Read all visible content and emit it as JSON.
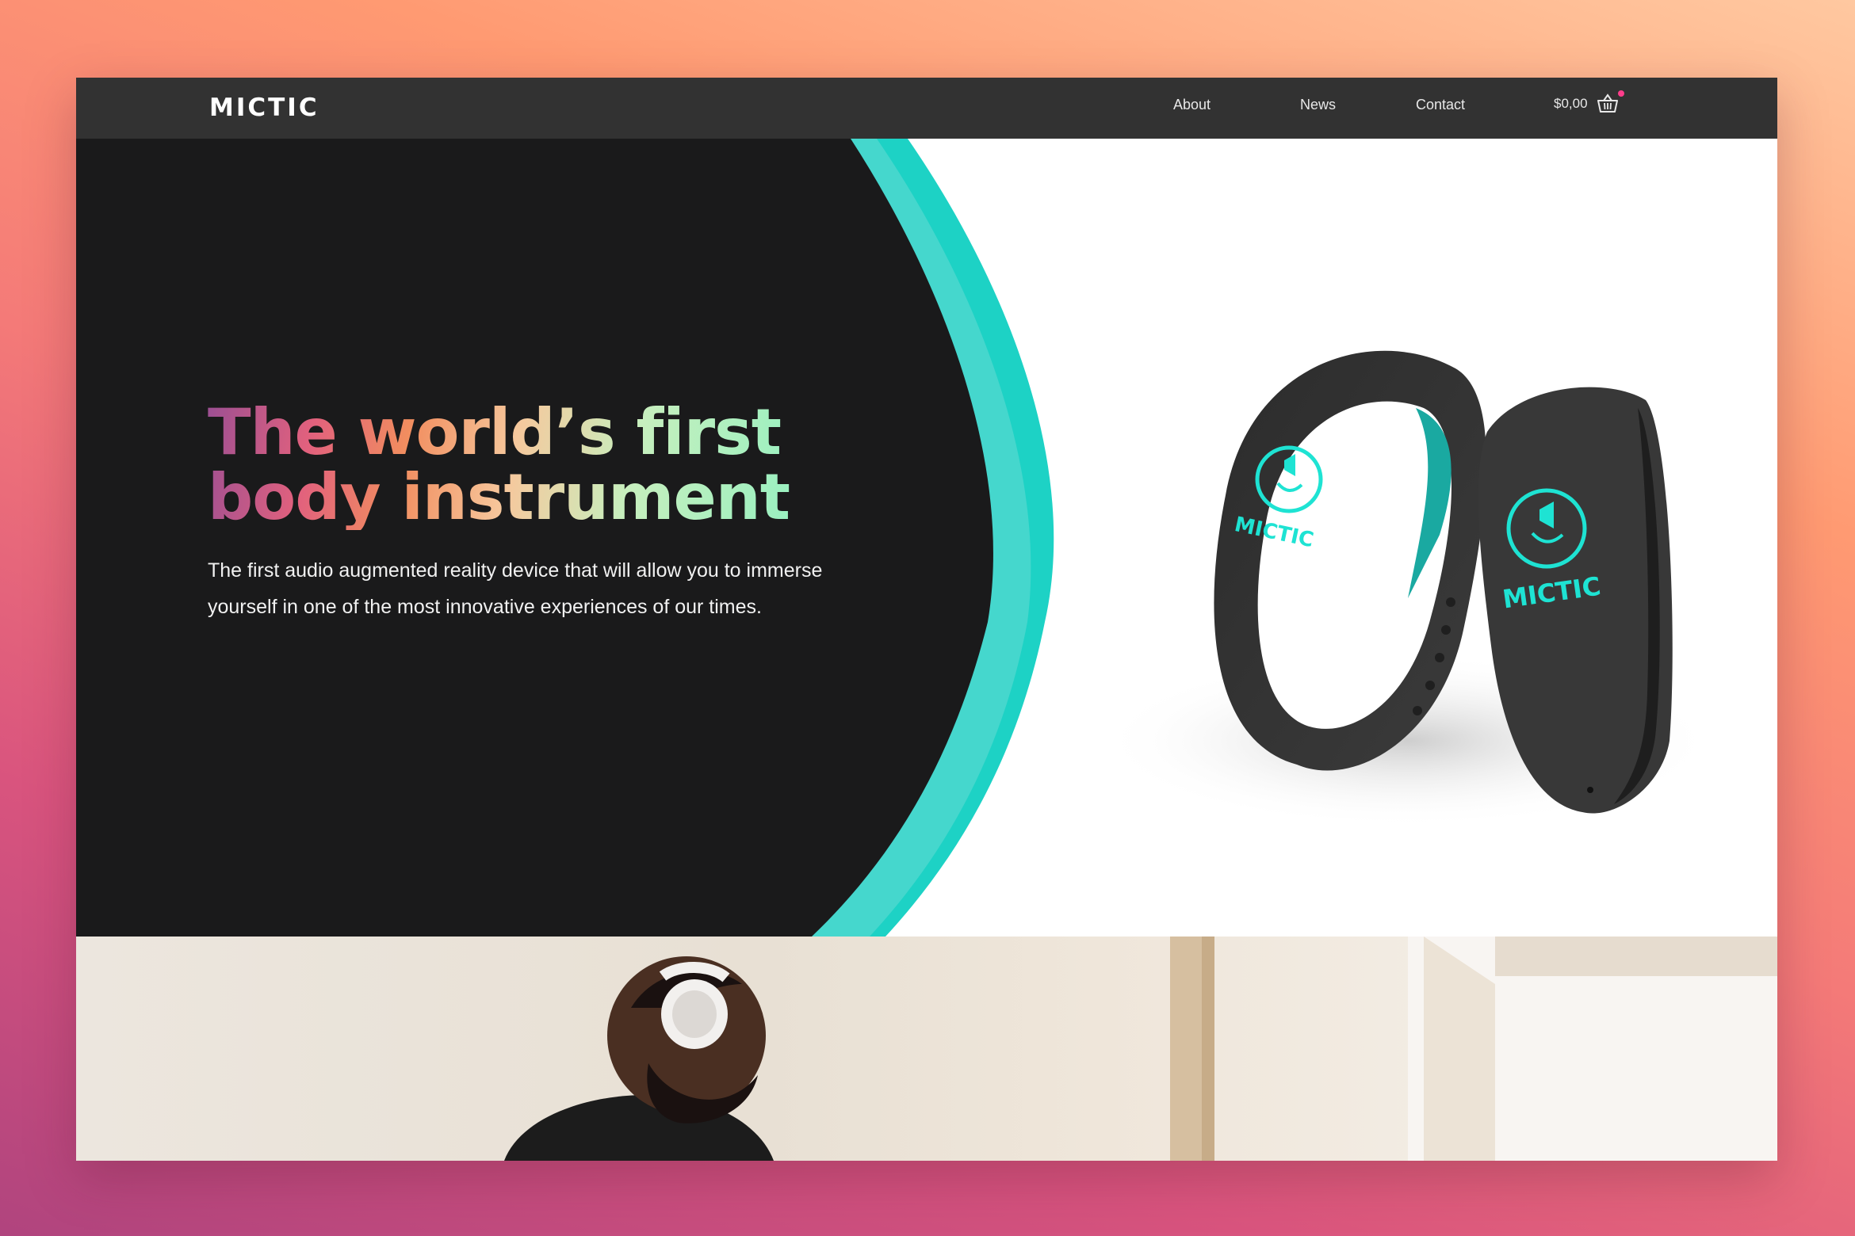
{
  "brand": {
    "name": "MICTIC"
  },
  "nav": {
    "items": [
      {
        "label": "About"
      },
      {
        "label": "News"
      },
      {
        "label": "Contact"
      }
    ],
    "cart_total": "$0,00",
    "cart_icon": "basket-icon"
  },
  "hero": {
    "title_line1": "The world’s first",
    "title_line2": "body instrument",
    "description_line1": "The first audio augmented reality device that will allow you to immerse",
    "description_line2": "yourself in one of the most innovative experiences of our times.",
    "band_logo": "MICTIC"
  },
  "colors": {
    "nav_bg": "#323232",
    "hero_dark": "#1a1a1b",
    "accent_teal": "#1fd3c6",
    "cart_badge": "#ff3d8b"
  }
}
